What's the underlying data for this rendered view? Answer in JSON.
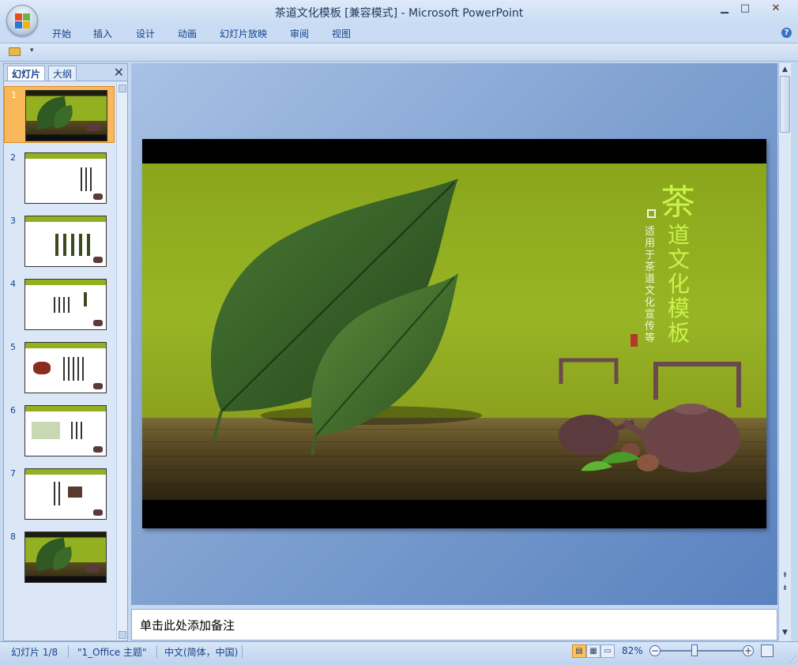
{
  "window": {
    "title": "茶道文化模板 [兼容模式] - Microsoft PowerPoint"
  },
  "window_controls": {
    "minimize": "▁",
    "maximize": "□",
    "close": "✕"
  },
  "ribbon": {
    "tabs": [
      {
        "label": "开始"
      },
      {
        "label": "插入"
      },
      {
        "label": "设计"
      },
      {
        "label": "动画"
      },
      {
        "label": "幻灯片放映"
      },
      {
        "label": "审阅"
      },
      {
        "label": "视图"
      }
    ],
    "help": "?"
  },
  "qat": {
    "dropdown": "▾"
  },
  "left_panel": {
    "tabs": [
      {
        "label": "幻灯片"
      },
      {
        "label": "大纲"
      }
    ],
    "close": "✕",
    "slides": [
      {
        "number": "1",
        "selected": true
      },
      {
        "number": "2"
      },
      {
        "number": "3"
      },
      {
        "number": "4"
      },
      {
        "number": "5"
      },
      {
        "number": "6"
      },
      {
        "number": "7"
      },
      {
        "number": "8"
      }
    ]
  },
  "slide": {
    "title_first_char": "茶",
    "title_rest": "道文化模板",
    "subtitle": "适用于茶道文化宣传等"
  },
  "notes": {
    "placeholder": "单击此处添加备注"
  },
  "statusbar": {
    "slide_indicator": "幻灯片 1/8",
    "theme": "\"1_Office 主题\"",
    "language": "中文(简体，中国)",
    "zoom": "82%",
    "zoom_fraction": 0.41
  },
  "colors": {
    "slide_green": "#98b526",
    "title_green": "#c9f24a",
    "selected_thumb": "#f9b85a"
  }
}
